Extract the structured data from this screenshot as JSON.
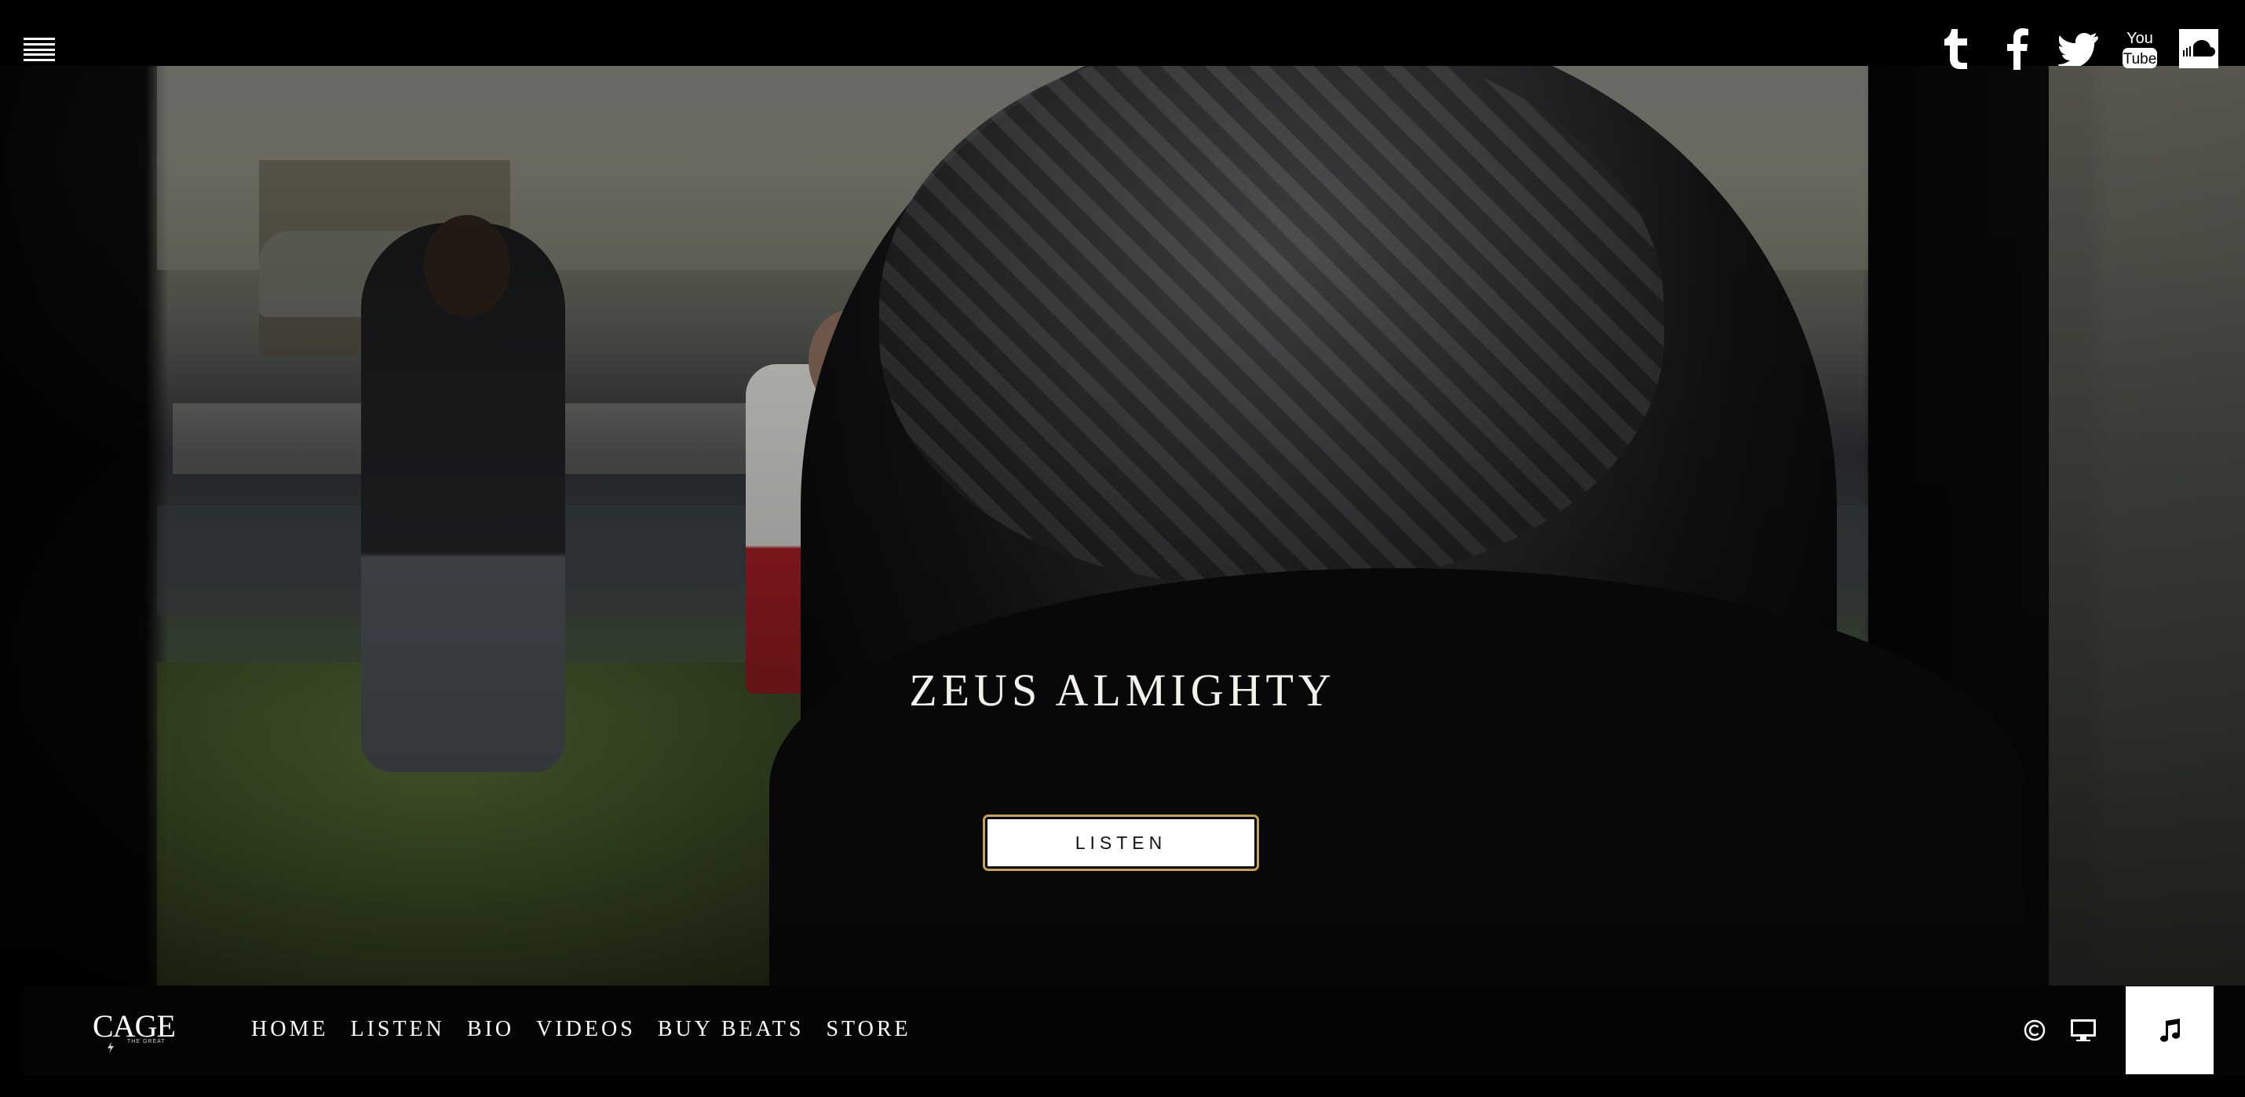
{
  "hero": {
    "title": "ZEUS ALMIGHTY",
    "button_label": "LISTEN"
  },
  "social": {
    "items": [
      {
        "name": "tumblr-icon"
      },
      {
        "name": "facebook-icon"
      },
      {
        "name": "twitter-icon"
      },
      {
        "name": "youtube-icon",
        "text_top": "You",
        "text_bottom": "Tube"
      },
      {
        "name": "soundcloud-icon"
      }
    ]
  },
  "logo": {
    "word": "CAGE",
    "sub": "THE GREAT"
  },
  "nav": {
    "items": [
      "HOME",
      "LISTEN",
      "BIO",
      "VIDEOS",
      "BUY BEATS",
      "STORE"
    ]
  },
  "colors": {
    "background": "#000000",
    "button_outline": "#c9a24c",
    "text": "#ffffff"
  }
}
